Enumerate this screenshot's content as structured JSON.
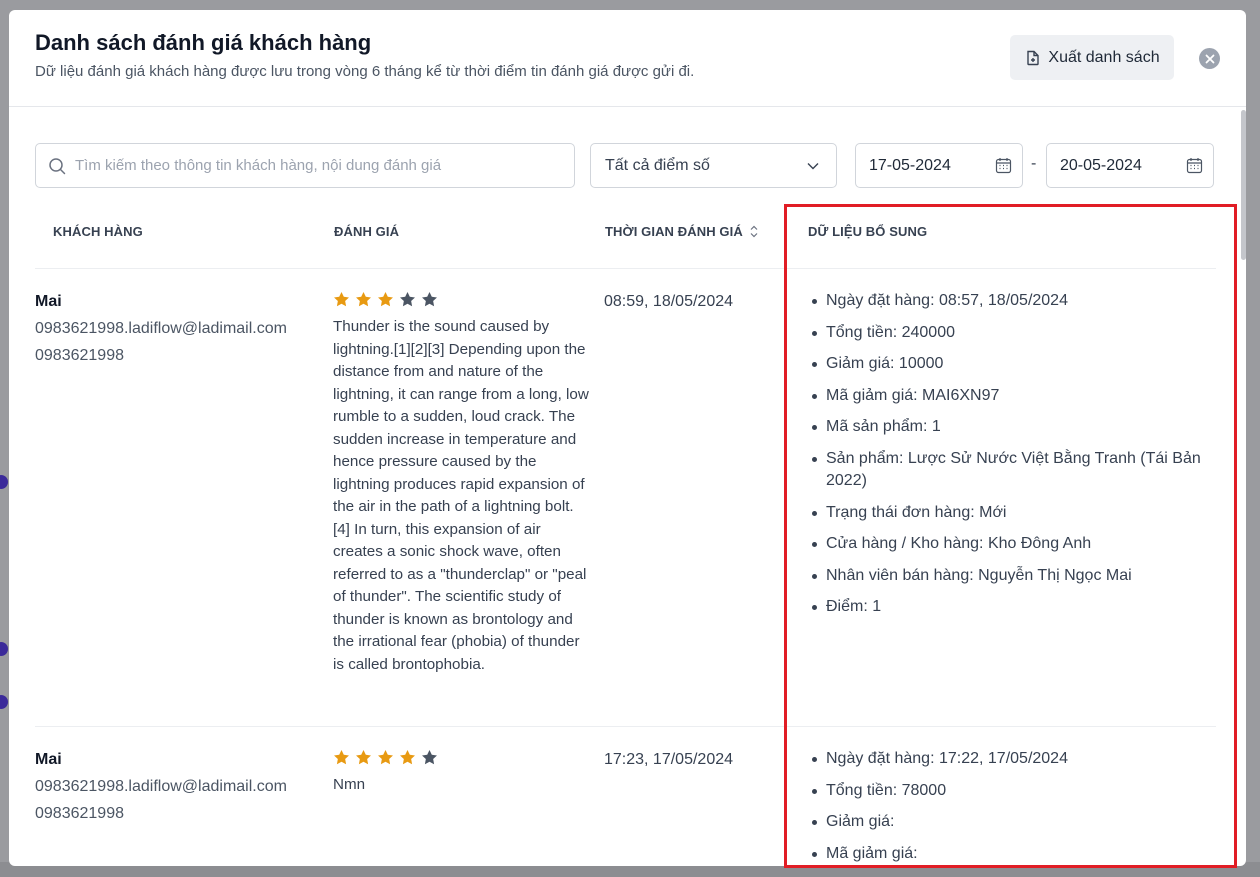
{
  "modal": {
    "title": "Danh sách đánh giá khách hàng",
    "subtitle": "Dữ liệu đánh giá khách hàng được lưu trong vòng 6 tháng kể từ thời điểm tin đánh giá được gửi đi.",
    "export_label": "Xuất danh sách"
  },
  "filters": {
    "search_placeholder": "Tìm kiếm theo thông tin khách hàng, nội dung đánh giá",
    "score_selected": "Tất cả điểm số",
    "date_from": "17-05-2024",
    "date_separator": "-",
    "date_to": "20-05-2024"
  },
  "table": {
    "headers": {
      "customer": "KHÁCH HÀNG",
      "rating": "ĐÁNH GIÁ",
      "time": "THỜI GIAN ĐÁNH GIÁ",
      "extra": "DỮ LIỆU BỔ SUNG"
    },
    "rows": [
      {
        "name": "Mai",
        "email": "0983621998.ladiflow@ladimail.com",
        "phone": "0983621998",
        "stars": 3,
        "max_stars": 5,
        "review": "Thunder is the sound caused by lightning.[1][2][3] Depending upon the distance from and nature of the lightning, it can range from a long, low rumble to a sudden, loud crack. The sudden increase in temperature and hence pressure caused by the lightning produces rapid expansion of the air in the path of a lightning bolt.[4] In turn, this expansion of air creates a sonic shock wave, often referred to as a \"thunderclap\" or \"peal of thunder\". The scientific study of thunder is known as brontology and the irrational fear (phobia) of thunder is called brontophobia.",
        "time": "08:59, 18/05/2024",
        "extra": [
          "Ngày đặt hàng: 08:57, 18/05/2024",
          "Tổng tiền: 240000",
          "Giảm giá: 10000",
          "Mã giảm giá: MAI6XN97",
          "Mã sản phẩm: 1",
          "Sản phẩm: Lược Sử Nước Việt Bằng Tranh (Tái Bản 2022)",
          "Trạng thái đơn hàng: Mới",
          "Cửa hàng / Kho hàng: Kho Đông Anh",
          "Nhân viên bán hàng: Nguyễn Thị Ngọc Mai",
          "Điểm: 1"
        ]
      },
      {
        "name": "Mai",
        "email": "0983621998.ladiflow@ladimail.com",
        "phone": "0983621998",
        "stars": 4,
        "max_stars": 5,
        "review": "Nmn",
        "time": "17:23, 17/05/2024",
        "extra": [
          "Ngày đặt hàng: 17:22, 17/05/2024",
          "Tổng tiền: 78000",
          "Giảm giá:",
          "Mã giảm giá:"
        ]
      }
    ]
  },
  "colors": {
    "star_on": "#e89a12",
    "star_off": "#4b5563",
    "highlight": "#e11d25"
  },
  "icons": [
    "file-export-icon",
    "close-icon",
    "search-icon",
    "chevron-down-icon",
    "calendar-icon",
    "sort-icon",
    "star-icon"
  ]
}
